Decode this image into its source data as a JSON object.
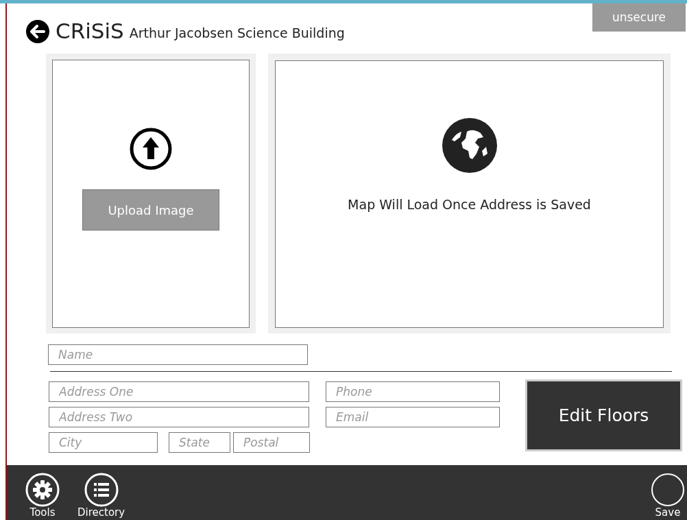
{
  "header": {
    "app_name": "CRiSiS",
    "building_name": "Arthur Jacobsen Science Building",
    "security_badge": "unsecure"
  },
  "image_panel": {
    "upload_button": "Upload Image"
  },
  "map_panel": {
    "message": "Map Will Load Once Address is Saved"
  },
  "form": {
    "name": {
      "placeholder": "Name"
    },
    "address_one": {
      "placeholder": "Address One"
    },
    "address_two": {
      "placeholder": "Address Two"
    },
    "city": {
      "placeholder": "City"
    },
    "state": {
      "placeholder": "State"
    },
    "postal": {
      "placeholder": "Postal"
    },
    "phone": {
      "placeholder": "Phone"
    },
    "email": {
      "placeholder": "Email"
    }
  },
  "edit_floors_button": "Edit Floors",
  "app_bar": [
    {
      "kind": "tools",
      "label": "Tools"
    },
    {
      "kind": "directory",
      "label": "Directory"
    },
    {
      "kind": "save",
      "label": "Save"
    }
  ]
}
